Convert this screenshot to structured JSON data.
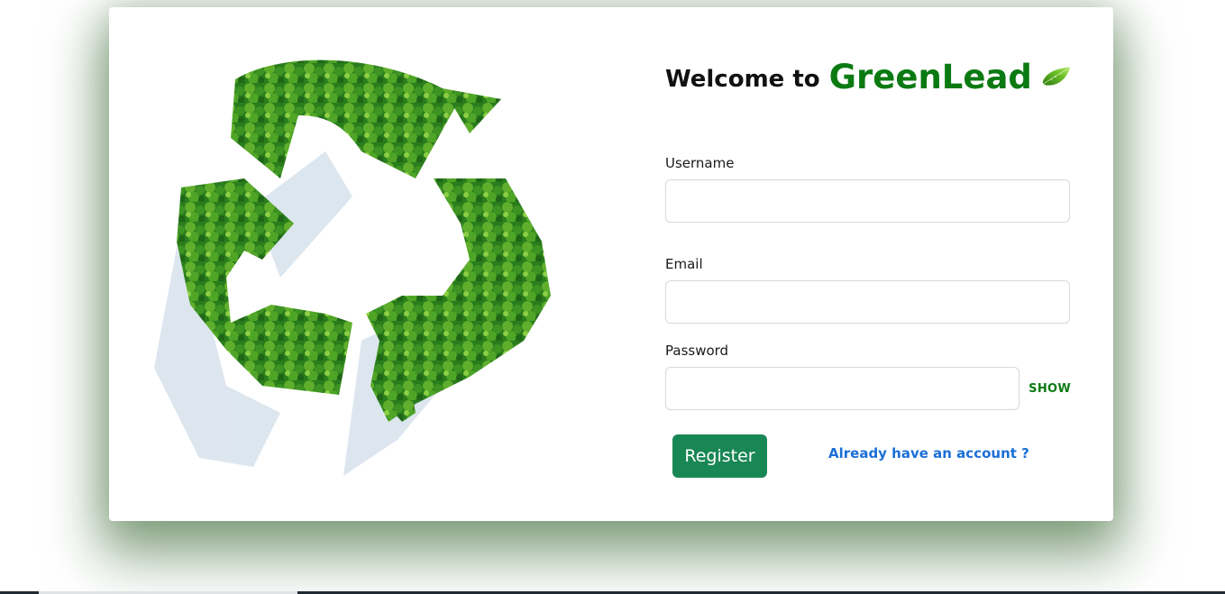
{
  "brand": {
    "welcome_prefix": "Welcome to",
    "name": "GreenLead",
    "logo_icon": "leaf-icon",
    "accent_color": "#0b7a12"
  },
  "illustration": {
    "icon": "recycle-trees-icon"
  },
  "form": {
    "username_label": "Username",
    "username_value": "",
    "email_label": "Email",
    "email_value": "",
    "password_label": "Password",
    "password_value": "",
    "show_label": "SHOW",
    "register_label": "Register",
    "login_link_label": "Already have an account ?"
  },
  "colors": {
    "register_button": "#198754",
    "link": "#1b6fd6"
  }
}
